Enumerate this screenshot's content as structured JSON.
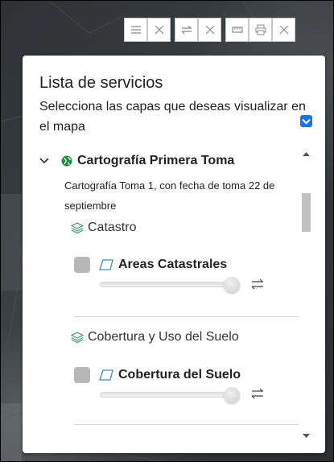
{
  "panel": {
    "title": "Lista de servicios",
    "description": "Selecciona las capas que deseas visualizar en el mapa"
  },
  "service": {
    "title": "Cartografía Primera Toma",
    "description": "Cartografía Toma 1, con fecha de toma 22 de septiembre"
  },
  "groups": [
    {
      "title": "Catastro",
      "layer": "Areas Catastrales",
      "opacity": 1.0,
      "checked": false
    },
    {
      "title": "Cobertura y Uso del Suelo",
      "layer": "Cobertura del Suelo",
      "opacity": 1.0,
      "checked": false
    }
  ],
  "toolbar": {
    "icons": [
      "hamburger-icon",
      "close-icon",
      "swap-arrows-icon",
      "close-icon",
      "ruler-icon",
      "print-icon",
      "close-icon"
    ]
  },
  "colors": {
    "accent": "#1a73e8",
    "group_icon": "#3c9a5f",
    "globe": "#1e8a3e",
    "polygon_icon": "#3a8fc0"
  }
}
